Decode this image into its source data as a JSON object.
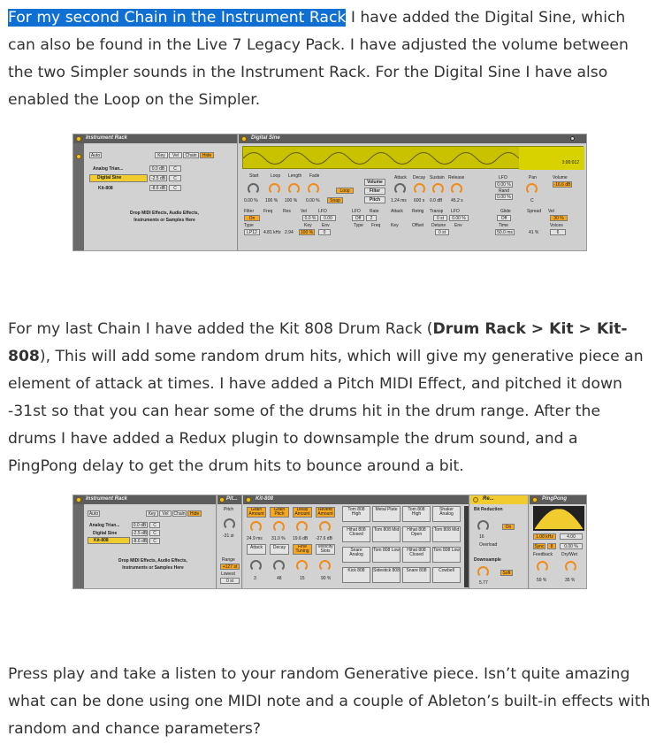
{
  "paragraph1": {
    "highlight": "For my second Chain in the Instrument Rack",
    "text": " I have added the Digital Sine, which can also be found in the Live 7 Legacy Pack. I have adjusted the volume between the two Simpler sounds in the Instrument Rack. For the Digital Sine I have also enabled the Loop on the Simpler."
  },
  "screenshot1": {
    "rack_title": "Instrument Rack",
    "auto_label": "Auto",
    "tabs": [
      "Key",
      "Vel",
      "Chain",
      "Hide"
    ],
    "chains": [
      {
        "name": "Analog Trian...",
        "vol": "0.0 dB",
        "pan": "C"
      },
      {
        "name": "Digital Sine",
        "vol": "-2.5 dB",
        "pan": "C"
      },
      {
        "name": "Kit-808",
        "vol": "-8.6 dB",
        "pan": "C"
      }
    ],
    "drop_text": "Drop MIDI Effects, Audio Effects, Instruments or Samples Here",
    "device_title": "Digital Sine",
    "time_readout": "0:00:012",
    "param_labels": [
      "Start",
      "Loop",
      "Length",
      "Fade"
    ],
    "param_values": [
      "0.00 %",
      "100 %",
      "100 %",
      "0.00 %",
      "Snap"
    ],
    "loop_label": "Loop",
    "volume_tabs": [
      "Volume",
      "Filter",
      "Pitch"
    ],
    "env_labels": [
      "Attack",
      "Decay",
      "Sustain",
      "Release"
    ],
    "env_values": [
      "1.24 ms",
      "600 s",
      "0.0 dB",
      "45.2 s"
    ],
    "lfo_label": "LFO",
    "lfo_values": [
      "0.00 %",
      "Rand",
      "0.00 %"
    ],
    "pan_label": "Pan",
    "volume_label": "Volume",
    "volume_value": "-16.6 dB",
    "filter_row": [
      "Filter",
      "Freq",
      "Res",
      "Vel",
      "LFO",
      "LFO",
      "Rate",
      "Attack",
      "Retrig",
      "Transp",
      "LFO",
      "Glide",
      "Spread",
      "Vel"
    ],
    "filter_on": "On",
    "filter_type": "LP12",
    "filter_values": [
      "4.81 kHz",
      "2.94",
      "100 %",
      "0.0 %",
      "0.00",
      "Off",
      "2",
      "0 st",
      "0.00 %",
      "Off",
      "30 %"
    ],
    "bottom_labels": [
      "Type",
      "Key",
      "Env",
      "Type",
      "Freq",
      "Key",
      "Offset",
      "Detune",
      "Env",
      "Time",
      "Voices"
    ],
    "bottom_values": [
      "0",
      "0 st",
      "50.0 ms",
      "41 %",
      "6"
    ],
    "center_c": "C"
  },
  "paragraph2": {
    "text1": "For my last Chain I have added the Kit 808 Drum Rack (",
    "bold": "Drum Rack > Kit > Kit-808",
    "text2": "), This will add some random drum hits, which will give my generative piece an element of attack at times. I have added a Pitch MIDI Effect, and pitched it down -31st so that you can hear some of the drums hit in the drum range. After the drums I have added a Redux plugin to downsample the drum sound, and a PingPong delay to get the drum hits to bounce around a bit."
  },
  "screenshot2": {
    "rack_title": "Instrument Rack",
    "auto_label": "Auto",
    "tabs": [
      "Key",
      "Vel",
      "Chain",
      "Hide"
    ],
    "chains": [
      {
        "name": "Analog Trian...",
        "vol": "0.0 dB",
        "pan": "C"
      },
      {
        "name": "Digital Sine",
        "vol": "-2.5 dB",
        "pan": "C"
      },
      {
        "name": "Kit-808",
        "vol": "-8.6 dB",
        "pan": "C"
      }
    ],
    "drop_text": "Drop MIDI Effects, Audio Effects, Instruments or Samples Here",
    "pitch_title": "Pit...",
    "pitch_label": "Pitch",
    "pitch_value": "-31 st",
    "range_label": "Range",
    "range_values": [
      "+127 st",
      "Lowest",
      "0 st"
    ],
    "kit_title": "Kit-808",
    "macros_top": [
      "Grain Amount",
      "Grain Pitch",
      "Delay Amount",
      "Reverb Amount"
    ],
    "macro_values_top": [
      "24.9 ms",
      "31.0 %",
      "19.6 dB",
      "-27.6 dB"
    ],
    "macros_bottom": [
      "Attack",
      "Decay",
      "Fine Tuning",
      "Velocity Slots"
    ],
    "macro_values_bottom": [
      "3",
      "48",
      "15",
      "90 %"
    ],
    "pads": [
      [
        "Tom 808 High",
        "Metal Plate",
        "Tom 808 High",
        "Shaker Analog"
      ],
      [
        "Hihat 808 Closed",
        "Tom 808 Mid",
        "Hihat 808 Open",
        "Tom 808 Mid"
      ],
      [
        "Snare Analog",
        "Tom 808 Low",
        "Hihat 808 Closed",
        "Tom 808 Low"
      ],
      [
        "Kick 808",
        "Sidestick 808",
        "Snare 808",
        "Cowbell"
      ]
    ],
    "redux_title": "Re...",
    "bit_reduction_label": "Bit Reduction",
    "bit_value": "16",
    "bit_on": "On",
    "overload_label": "Overload",
    "downsample_label": "Downsample",
    "downsample_value": "5.77",
    "soft_label": "Soft",
    "pingpong_title": "PingPong",
    "pingpong_values": [
      "1.08 kHz",
      "4.00"
    ],
    "sync_label": "Sync",
    "sync_value": "8",
    "sync_pct": "0.00 %",
    "feedback_label": "Feedback",
    "drywet_label": "Dry/Wet",
    "feedback_value": "59 %",
    "drywet_value": "35 %"
  },
  "paragraph3": {
    "text": "Press play and take a listen to your random Generative piece. Isn’t quite amazing what can be done using one MIDI note and a couple of Ableton’s built-in effects with random and chance parameters?"
  }
}
